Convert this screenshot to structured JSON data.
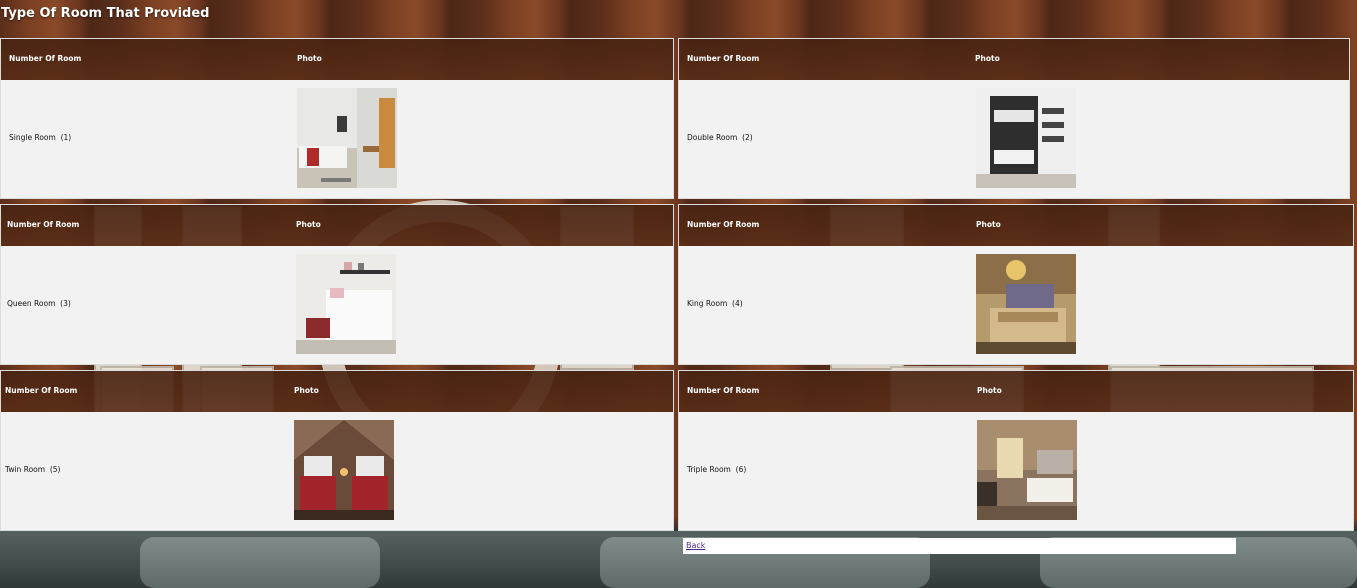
{
  "page": {
    "title": "Type Of Room That Provided"
  },
  "columns": {
    "number_header": "Number Of Room",
    "photo_header": "Photo"
  },
  "rooms": [
    {
      "name": "Single Room",
      "count": "(1)",
      "photo_icon": "single-room-photo"
    },
    {
      "name": "Double Room",
      "count": "(2)",
      "photo_icon": "double-room-photo"
    },
    {
      "name": "Queen Room",
      "count": "(3)",
      "photo_icon": "queen-room-photo"
    },
    {
      "name": "King Room",
      "count": "(4)",
      "photo_icon": "king-room-photo"
    },
    {
      "name": "Twin Room",
      "count": "(5)",
      "photo_icon": "twin-room-photo"
    },
    {
      "name": "Triple Room",
      "count": "(6)",
      "photo_icon": "triple-room-photo"
    }
  ],
  "nav": {
    "back_label": "Back"
  },
  "colors": {
    "header_bg": "#5a2c16",
    "body_bg": "#f2f2f2",
    "link": "#4b2a8a"
  }
}
